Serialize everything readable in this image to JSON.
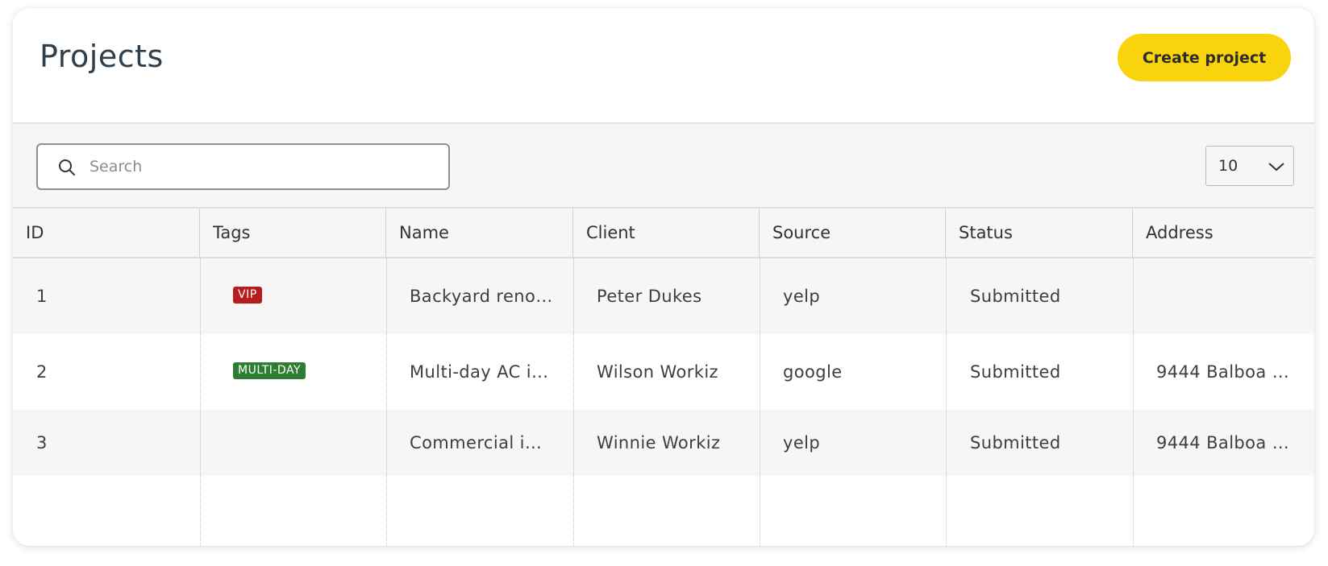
{
  "header": {
    "title": "Projects",
    "create_label": "Create project"
  },
  "toolbar": {
    "search_placeholder": "Search",
    "search_value": "",
    "page_size": "10"
  },
  "table": {
    "columns": [
      "ID",
      "Tags",
      "Name",
      "Client",
      "Source",
      "Status",
      "Address"
    ],
    "rows": [
      {
        "id": "1",
        "tag": {
          "label": "VIP",
          "color": "#b61c1c"
        },
        "name": "Backyard reno…",
        "client": "Peter Dukes",
        "source": "yelp",
        "status": "Submitted",
        "address": ""
      },
      {
        "id": "2",
        "tag": {
          "label": "MULTI-DAY",
          "color": "#2e7d32"
        },
        "name": "Multi-day AC i…",
        "client": "Wilson Workiz",
        "source": "google",
        "status": "Submitted",
        "address": "9444 Balboa A…"
      },
      {
        "id": "3",
        "tag": null,
        "name": "Commercial i…",
        "client": "Winnie Workiz",
        "source": "yelp",
        "status": "Submitted",
        "address": "9444 Balboa A…"
      }
    ]
  },
  "colors": {
    "accent": "#f9d30b",
    "title": "#2f3f4b",
    "tag_vip": "#b61c1c",
    "tag_multiday": "#2e7d32"
  },
  "icons": {
    "search": "search-icon",
    "dropdown": "chevron-down-icon"
  }
}
